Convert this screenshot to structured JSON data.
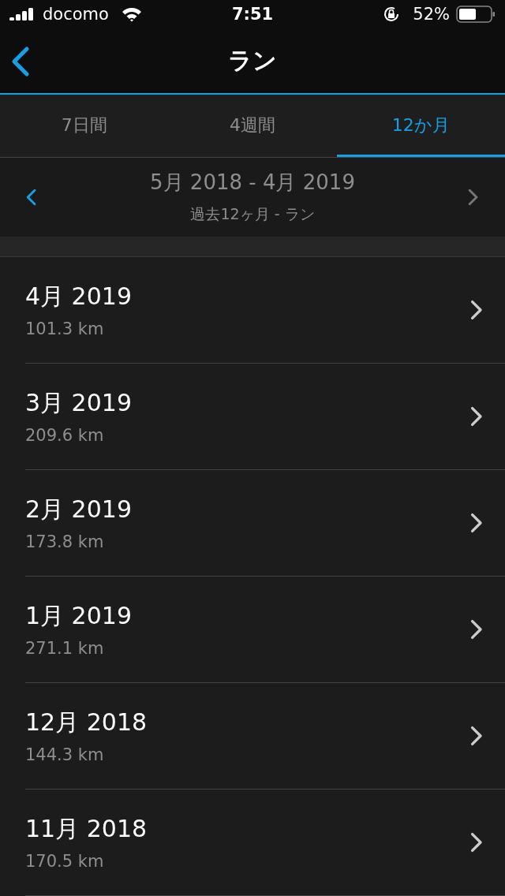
{
  "status_bar": {
    "carrier": "docomo",
    "time": "7:51",
    "battery": "52%"
  },
  "nav": {
    "title": "ラン"
  },
  "tabs": [
    {
      "label": "7日間",
      "selected": false
    },
    {
      "label": "4週間",
      "selected": false
    },
    {
      "label": "12か月",
      "selected": true
    }
  ],
  "period": {
    "range": "5月 2018 - 4月 2019",
    "subtitle": "過去12ヶ月 - ラン",
    "prev_disabled": false,
    "next_disabled": true
  },
  "months": [
    {
      "month": "4月 2019",
      "distance": "101.3 km"
    },
    {
      "month": "3月 2019",
      "distance": "209.6 km"
    },
    {
      "month": "2月 2019",
      "distance": "173.8 km"
    },
    {
      "month": "1月 2019",
      "distance": "271.1 km"
    },
    {
      "month": "12月 2018",
      "distance": "144.3 km"
    },
    {
      "month": "11月 2018",
      "distance": "170.5 km"
    }
  ]
}
